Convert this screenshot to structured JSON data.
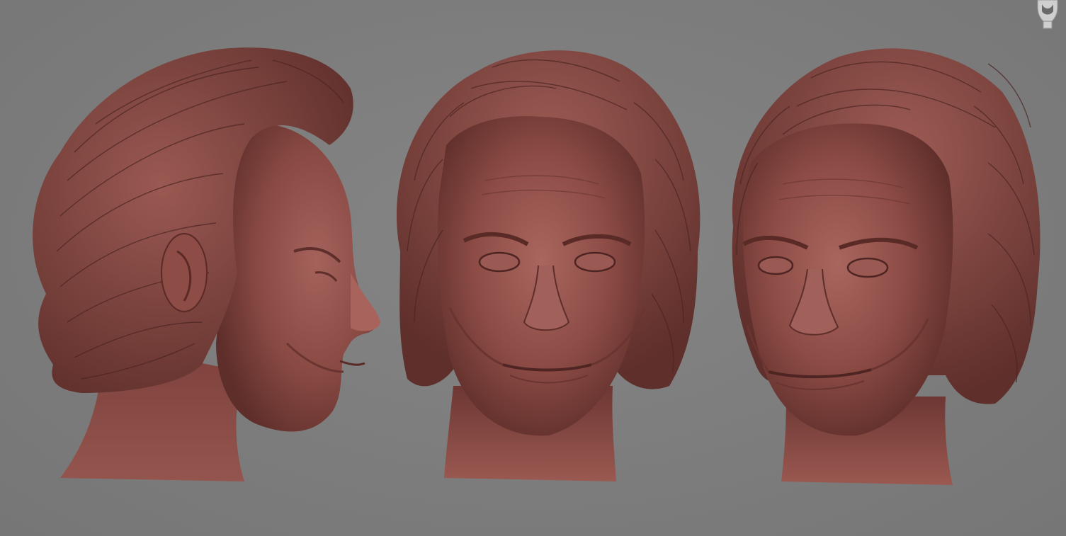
{
  "app": {
    "name": "",
    "background_color": "#7e7e7e",
    "material_color": "#8a4c46"
  },
  "viewport": {
    "views": [
      {
        "name": "side-view",
        "label": ""
      },
      {
        "name": "front-view",
        "label": ""
      },
      {
        "name": "three-quarter-view",
        "label": ""
      }
    ]
  },
  "nav_widget": {
    "icon": "orientation-head-icon"
  }
}
